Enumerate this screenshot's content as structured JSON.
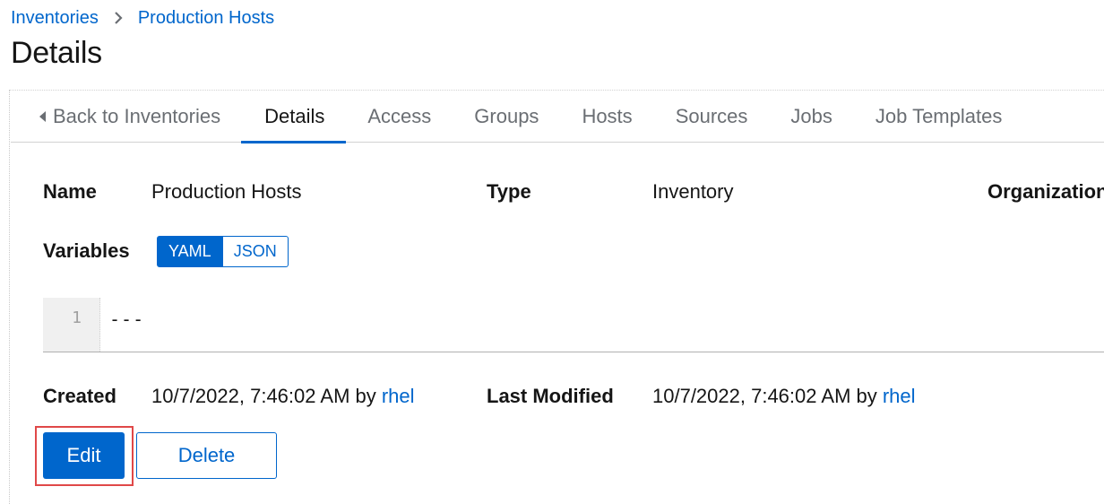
{
  "breadcrumb": {
    "parent": "Inventories",
    "current": "Production Hosts"
  },
  "page": {
    "title": "Details"
  },
  "tabs": {
    "back": "Back to Inventories",
    "items": [
      "Details",
      "Access",
      "Groups",
      "Hosts",
      "Sources",
      "Jobs",
      "Job Templates"
    ]
  },
  "details": {
    "name_label": "Name",
    "name_value": "Production Hosts",
    "type_label": "Type",
    "type_value": "Inventory",
    "org_label": "Organization",
    "variables_label": "Variables",
    "toggle_yaml": "YAML",
    "toggle_json": "JSON",
    "code_line_no": "1",
    "code_text": "---",
    "created_label": "Created",
    "created_value": "10/7/2022, 7:46:02 AM by",
    "created_user": "rhel",
    "modified_label": "Last Modified",
    "modified_value": "10/7/2022, 7:46:02 AM by",
    "modified_user": "rhel"
  },
  "actions": {
    "edit": "Edit",
    "delete": "Delete"
  },
  "colors": {
    "link": "#0066cc",
    "primary": "#0066cc",
    "highlight": "#e04848",
    "muted": "#6a6e73"
  }
}
